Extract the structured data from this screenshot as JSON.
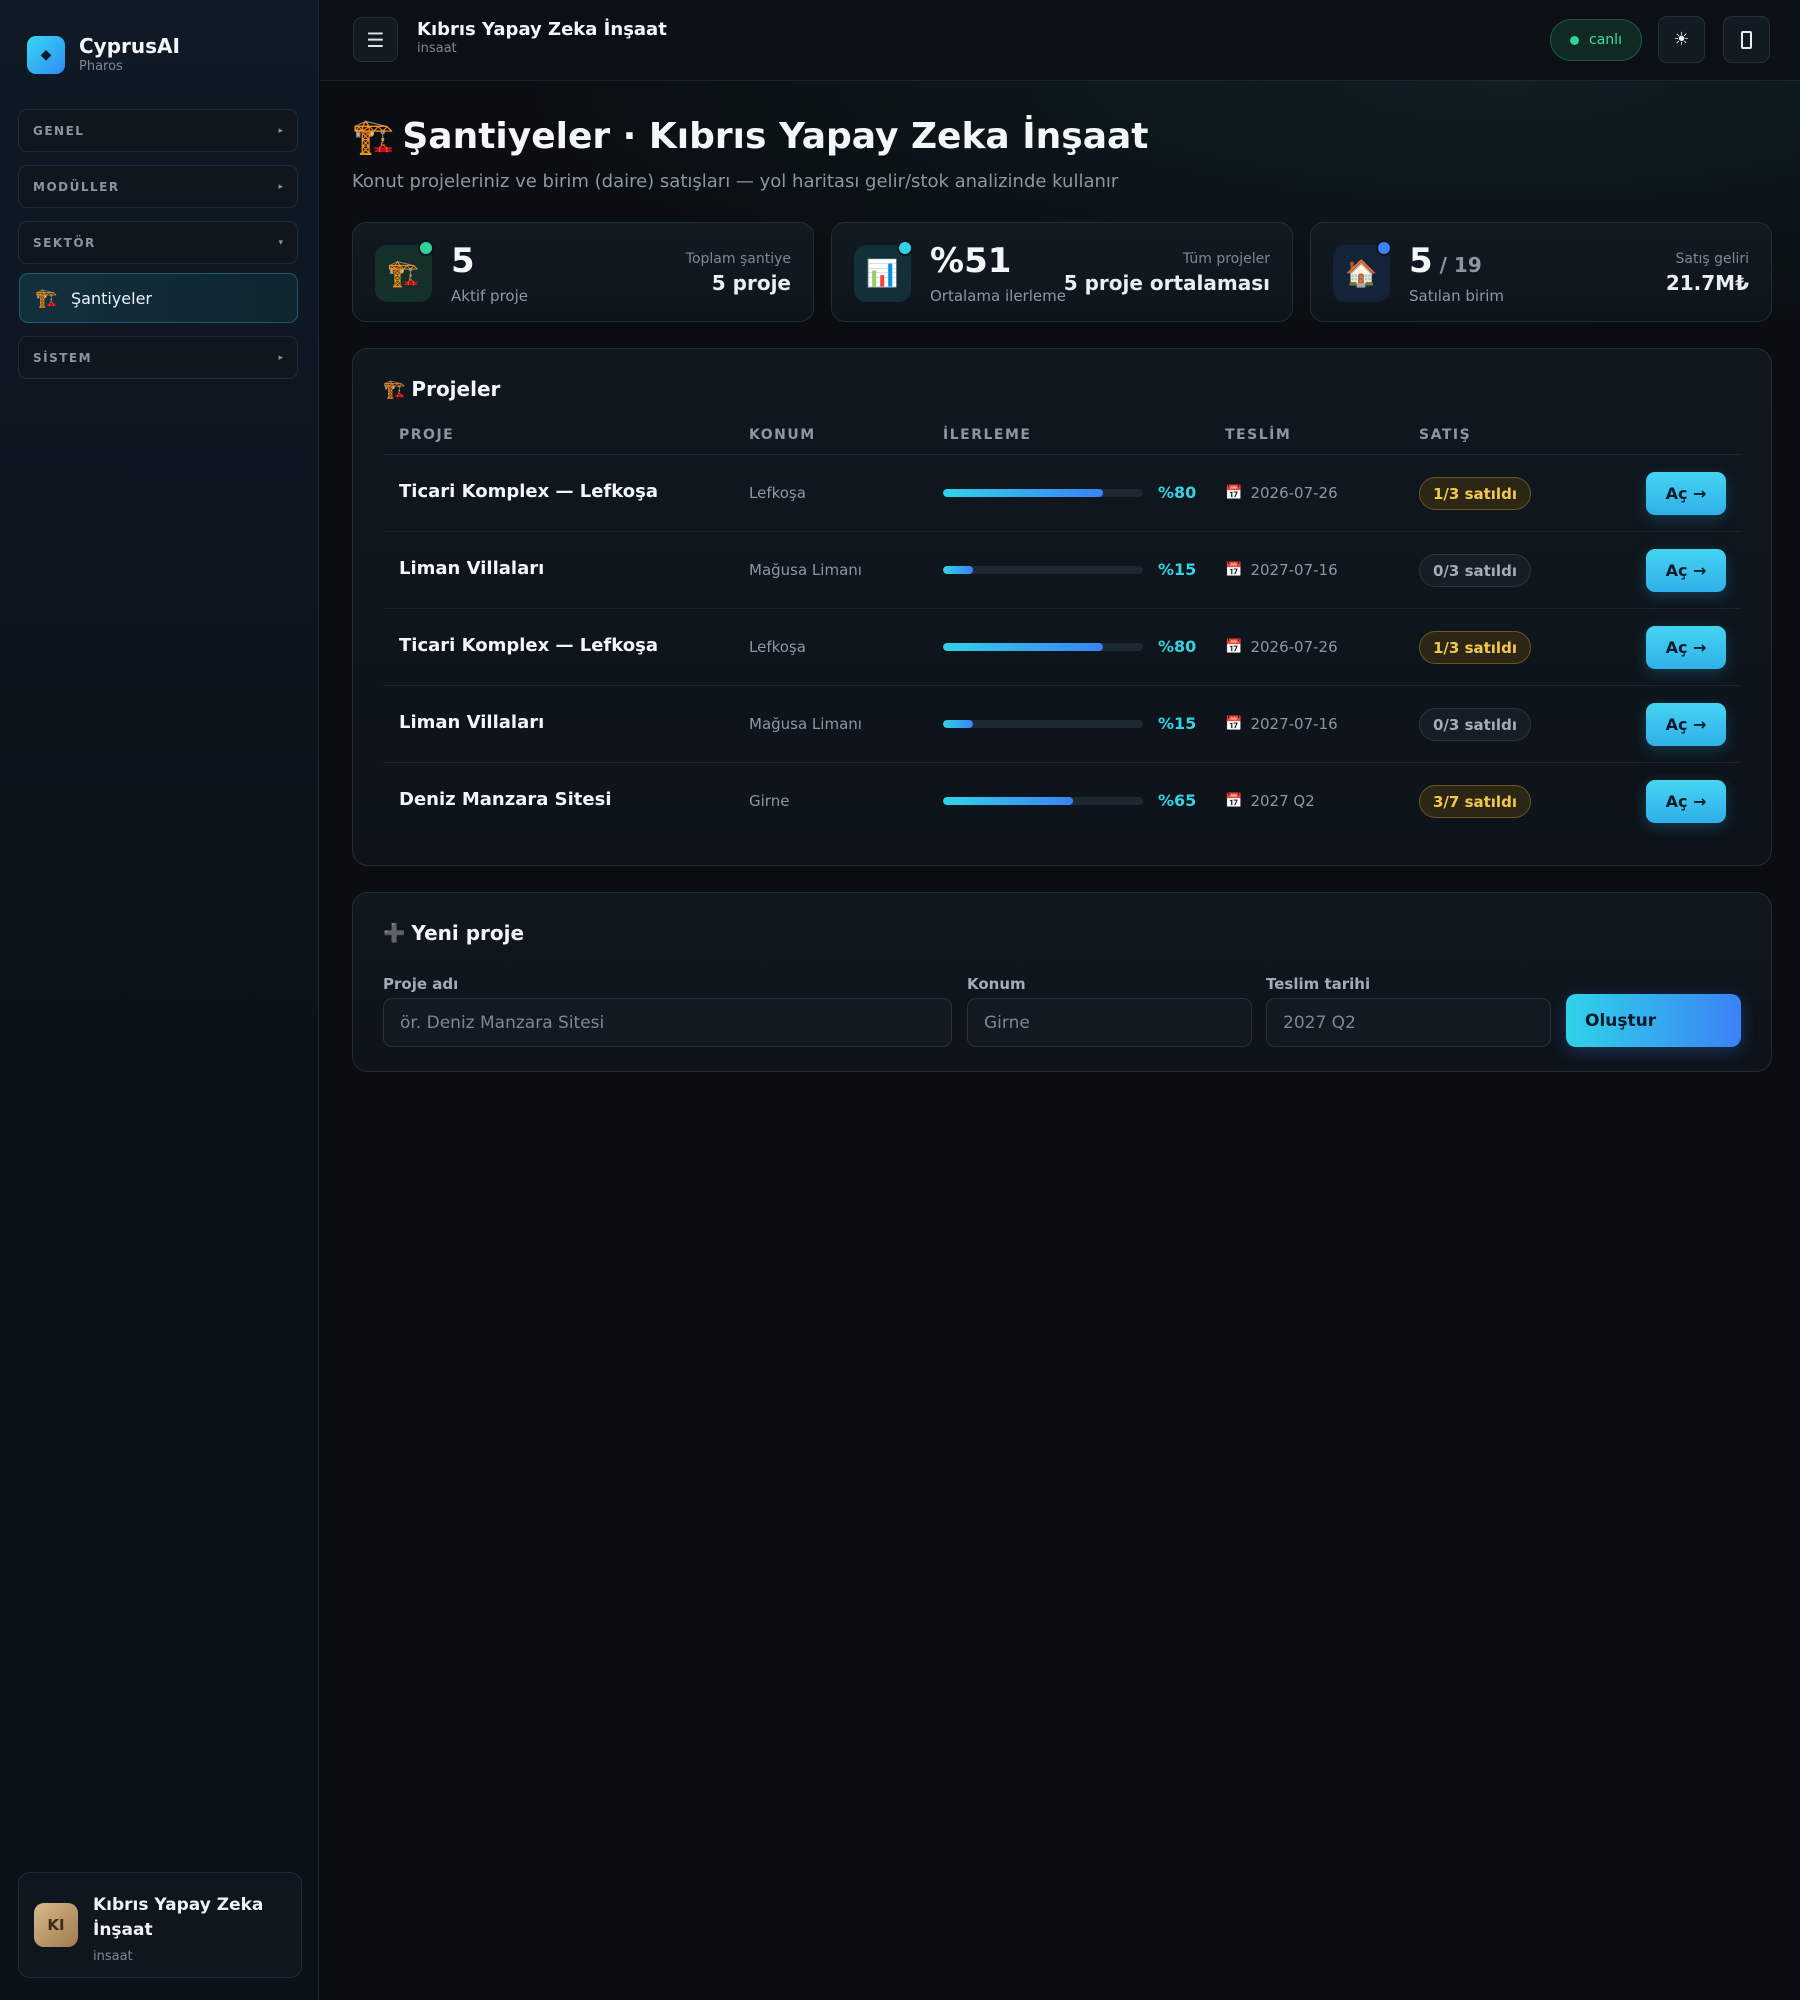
{
  "brand": {
    "name": "CyprusAI",
    "sub": "Pharos",
    "logo_icon": "diamond-icon"
  },
  "sidebar": {
    "groups": [
      {
        "label": "GENEL",
        "arrow": "▸"
      },
      {
        "label": "MODÜLLER",
        "arrow": "▸"
      },
      {
        "label": "SEKTÖR",
        "arrow": "▾"
      },
      {
        "label": "SİSTEM",
        "arrow": "▸"
      }
    ],
    "active_item": {
      "icon": "🏗️",
      "label": "Şantiyeler"
    }
  },
  "user": {
    "initials": "KI",
    "name": "Kıbrıs Yapay Zeka İnşaat",
    "role": "insaat"
  },
  "topbar": {
    "menu_icon": "☰",
    "title": "Kıbrıs Yapay Zeka İnşaat",
    "subtitle": "insaat",
    "status": "canlı",
    "theme_icon": "☀"
  },
  "page": {
    "icon": "🏗️",
    "title": "Şantiyeler · Kıbrıs Yapay Zeka İnşaat",
    "subtitle": "Konut projeleriniz ve birim (daire) satışları — yol haritası gelir/stok analizinde kullanır"
  },
  "stats": [
    {
      "icon": "🏗️",
      "value": "5",
      "value_small": "",
      "label": "Aktif proje",
      "side_key": "Toplam şantiye",
      "side_value": "5 proje",
      "dot_color": "#2ed39a",
      "icon_bg": "#14302a"
    },
    {
      "icon": "📊",
      "value": "%51",
      "value_small": "",
      "label": "Ortalama ilerleme",
      "side_key": "Tüm projeler",
      "side_value": "5 proje ortalaması",
      "dot_color": "#2fd3e8",
      "icon_bg": "#133038"
    },
    {
      "icon": "🏠",
      "value": "5",
      "value_small": " / 19",
      "label": "Satılan birim",
      "side_key": "Satış geliri",
      "side_value": "21.7M₺",
      "dot_color": "#3b82f6",
      "icon_bg": "#15233a"
    }
  ],
  "projects": {
    "title_icon": "🏗️",
    "title": "Projeler",
    "columns": [
      "PROJE",
      "KONUM",
      "İLERLEME",
      "TESLİM",
      "SATIŞ"
    ],
    "rows": [
      {
        "name": "Ticari Komplex — Lefkoşa",
        "location": "Lefkoşa",
        "progress": 80,
        "progress_label": "%80",
        "date": "2026-07-26",
        "sales": "1/3 satıldı",
        "sold": true,
        "action": "Aç →"
      },
      {
        "name": "Liman Villaları",
        "location": "Mağusa Limanı",
        "progress": 15,
        "progress_label": "%15",
        "date": "2027-07-16",
        "sales": "0/3 satıldı",
        "sold": false,
        "action": "Aç →"
      },
      {
        "name": "Ticari Komplex — Lefkoşa",
        "location": "Lefkoşa",
        "progress": 80,
        "progress_label": "%80",
        "date": "2026-07-26",
        "sales": "1/3 satıldı",
        "sold": true,
        "action": "Aç →"
      },
      {
        "name": "Liman Villaları",
        "location": "Mağusa Limanı",
        "progress": 15,
        "progress_label": "%15",
        "date": "2027-07-16",
        "sales": "0/3 satıldı",
        "sold": false,
        "action": "Aç →"
      },
      {
        "name": "Deniz Manzara Sitesi",
        "location": "Girne",
        "progress": 65,
        "progress_label": "%65",
        "date": "2027 Q2",
        "sales": "3/7 satıldı",
        "sold": true,
        "action": "Aç →"
      }
    ],
    "calendar_icon": "📅"
  },
  "new_project": {
    "title_icon": "➕",
    "title": "Yeni proje",
    "name_label": "Proje adı",
    "name_placeholder": "ör. Deniz Manzara Sitesi",
    "location_label": "Konum",
    "location_placeholder": "Girne",
    "date_label": "Teslim tarihi",
    "date_placeholder": "2027 Q2",
    "submit": "Oluştur"
  }
}
